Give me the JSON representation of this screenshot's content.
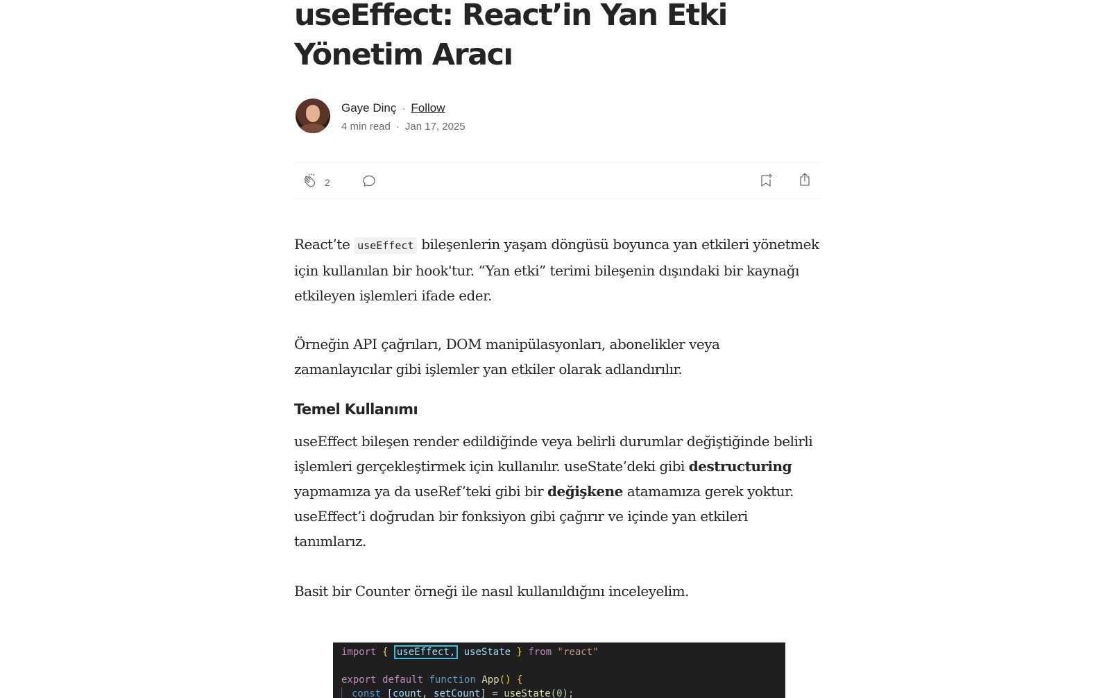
{
  "article": {
    "title": "useEffect: React’in Yan Etki Yönetim Aracı",
    "author": {
      "name": "Gaye Dinç",
      "follow_label": "Follow",
      "read_time": "4 min read",
      "date": "Jan 17, 2025",
      "separator": "·"
    },
    "actions": {
      "clap_count": "2"
    },
    "paragraphs": {
      "p1_before": "React’te ",
      "p1_code": "useEffect",
      "p1_after": " bileşenlerin yaşam döngüsü boyunca yan etkileri yönetmek için kullanılan bir hook'tur. “Yan etki” terimi bileşenin dışındaki bir kaynağı etkileyen işlemleri ifade eder.",
      "p2": "Örneğin API çağrıları, DOM manipülasyonları, abonelikler veya zamanlayıcılar gibi işlemler yan etkiler olarak adlandırılır.",
      "heading": "Temel Kullanımı",
      "p3_a": "useEffect bileşen render edildiğinde veya belirli durumlar değiştiğinde belirli işlemleri gerçekleştirmek için kullanılır. useState’deki gibi ",
      "p3_bold1": "destructuring",
      "p3_b": " yapmamıza ya da useRef’teki gibi bir ",
      "p3_bold2": "değişkene",
      "p3_c": " atamamıza gerek yoktur. useEffect’i doğrudan bir fonksiyon gibi çağırır ve içinde yan etkileri tanımlarız.",
      "p4": "Basit bir Counter örneği ile nasıl kullanıldığını inceleyelim."
    },
    "code_image": {
      "line1": {
        "kw_import": "import",
        "brace_open": "{",
        "hl_name": "useEffect,",
        "name2": "useState",
        "brace_close": "}",
        "kw_from": "from",
        "module": "\"react\""
      },
      "line2": {
        "kw_export": "export",
        "kw_default": "default",
        "kw_function": "function",
        "fn_name": "App",
        "parens": "()",
        "brace": "{"
      },
      "line3": {
        "kw_const": "const",
        "destructure": "[count, setCount]",
        "eq": "=",
        "fn_call": "useState",
        "arg": "(0);"
      }
    }
  }
}
